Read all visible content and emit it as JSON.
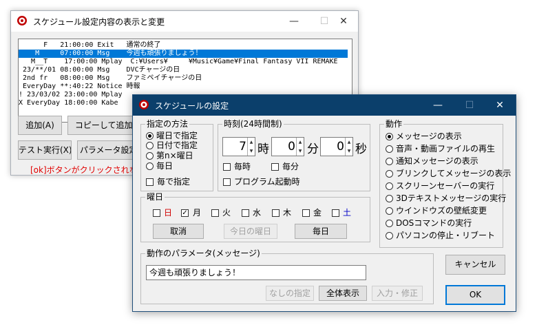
{
  "back_window": {
    "title": "スケジュール設定内容の表示と変更",
    "rows": [
      "      F   21:00:00 Exit   通常の終了",
      "    M     07:00:00 Msg    今週も頑張りましょう！",
      "   M__T    17:00:00 Mplay  C:¥Users¥     ¥Music¥Game¥Final Fantasy VII REMAKE",
      " 23/**/01 08:00:00 Msg    DVCチャージの日",
      " 2nd fr   08:00:00 Msg    ファミペイチャージの日",
      " EveryDay **:40:22 Notice 時報",
      "! 23/03/02 23:00:00 Mplay",
      "X EveryDay 18:00:00 Kabe"
    ],
    "selected_row": 1,
    "buttons": {
      "add": "追加(A)",
      "copy_add": "コピーして追加(",
      "test": "テスト実行(X)",
      "param": "パラメータ設定("
    },
    "warning": "[ok]ボタンがクリックされないと"
  },
  "front_window": {
    "title": "スケジュールの設定",
    "method": {
      "label": "指定の方法",
      "options": [
        "曜日で指定",
        "日付で指定",
        "第n×曜日",
        "毎日"
      ],
      "selected": 0,
      "every_label": "毎で指定"
    },
    "time": {
      "label": "時刻(24時間制)",
      "hour": "7",
      "minute": "0",
      "second": "0",
      "hour_unit": "時",
      "minute_unit": "分",
      "second_unit": "秒",
      "every_hour": "毎時",
      "every_minute": "毎分",
      "program_start": "プログラム起動時"
    },
    "weekday": {
      "label": "曜日",
      "days": [
        {
          "label": "日",
          "checked": false,
          "color": "#d00000"
        },
        {
          "label": "月",
          "checked": true,
          "color": "#000000"
        },
        {
          "label": "火",
          "checked": false,
          "color": "#000000"
        },
        {
          "label": "水",
          "checked": false,
          "color": "#000000"
        },
        {
          "label": "木",
          "checked": false,
          "color": "#000000"
        },
        {
          "label": "金",
          "checked": false,
          "color": "#000000"
        },
        {
          "label": "土",
          "checked": false,
          "color": "#0000c8"
        }
      ],
      "clear": "取消",
      "today": "今日の曜日",
      "everyday": "毎日"
    },
    "action": {
      "label": "動作",
      "options": [
        "メッセージの表示",
        "音声・動画ファイルの再生",
        "通知メッセージの表示",
        "ブリンクしてメッセージの表示",
        "スクリーンセーバーの実行",
        "3Dテキストメッセージの実行",
        "ウインドウズの壁紙変更",
        "DOSコマンドの実行",
        "パソコンの停止・リブート"
      ],
      "selected": 0
    },
    "param": {
      "label": "動作のパラメータ(メッセージ)",
      "value": "今週も頑張りましょう！",
      "none": "なしの指定",
      "show_all": "全体表示",
      "edit": "入力・修正"
    },
    "cancel": "キャンセル",
    "ok": "OK"
  }
}
